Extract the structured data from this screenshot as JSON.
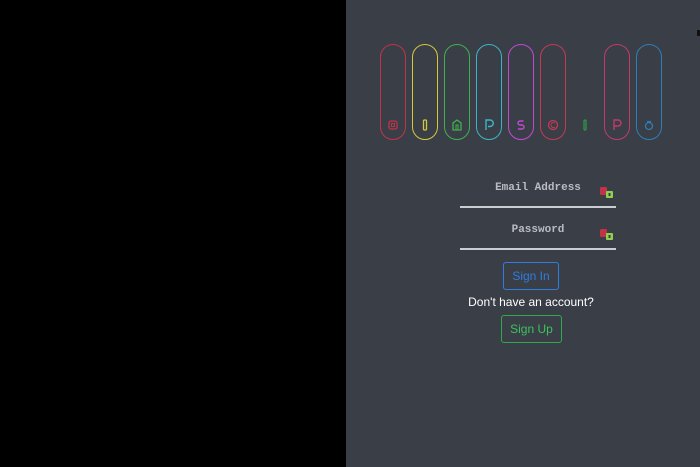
{
  "login": {
    "email_label": "Email Address",
    "password_label": "Password",
    "signin_label": "Sign In",
    "signup_prompt": "Don't have an account?",
    "signup_label": "Sign Up"
  },
  "pills": [
    {
      "icon": "square-icon",
      "color": "#c2334a"
    },
    {
      "icon": "bar-icon",
      "color": "#d3c93a"
    },
    {
      "icon": "house-icon",
      "color": "#3fb14d"
    },
    {
      "icon": "p-icon",
      "color": "#3ab5c9"
    },
    {
      "icon": "s-icon",
      "color": "#c04ad3"
    },
    {
      "icon": "c-icon",
      "color": "#c33a55"
    },
    {
      "icon": "line-icon",
      "color": "#2f9a4a"
    },
    {
      "icon": "p2-icon",
      "color": "#c23a6a"
    },
    {
      "icon": "a-icon",
      "color": "#2f7db8"
    }
  ],
  "colors": {
    "panel": "#3a3f47",
    "signin": "#2f7de1",
    "signup": "#3cc15e",
    "field_icon_red": "#c2334a",
    "field_icon_green": "#8fd14f"
  }
}
